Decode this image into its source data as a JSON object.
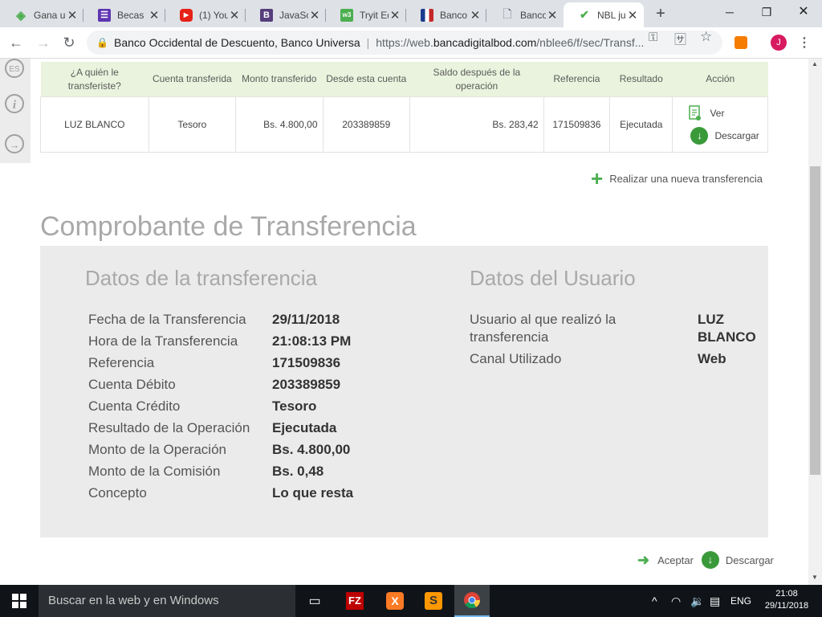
{
  "browser": {
    "tabs": [
      {
        "title": "Gana u",
        "active": false
      },
      {
        "title": "Becas",
        "active": false
      },
      {
        "title": "(1) You",
        "active": false
      },
      {
        "title": "JavaSc",
        "active": false
      },
      {
        "title": "Tryit Ed",
        "active": false
      },
      {
        "title": "Banco",
        "active": false
      },
      {
        "title": "Banco",
        "active": false
      },
      {
        "title": "NBL ju",
        "active": true
      }
    ],
    "new_tab": "+",
    "site_name": "Banco Occidental de Descuento, Banco Universa",
    "url_prefix": "https://web.",
    "url_domain": "bancadigitalbod.com",
    "url_path": "/nblee6/f/sec/Transf...",
    "profile_initial": "J"
  },
  "sidebar": {
    "lang": "ES",
    "info": "i",
    "logout": "→"
  },
  "table": {
    "headers": [
      "¿A quién le transferiste?",
      "Cuenta transferida",
      "Monto transferido",
      "Desde esta cuenta",
      "Saldo después de la operación",
      "Referencia",
      "Resultado",
      "Acción"
    ],
    "row": {
      "beneficiary": "LUZ BLANCO",
      "account": "Tesoro",
      "amount": "Bs. 4.800,00",
      "from_account": "203389859",
      "balance_after": "Bs. 283,42",
      "reference": "171509836",
      "result": "Ejecutada",
      "view_label": "Ver",
      "download_label": "Descargar"
    }
  },
  "new_transfer_label": "Realizar una nueva transferencia",
  "receipt": {
    "title": "Comprobante de Transferencia",
    "transfer_section": "Datos de la transferencia",
    "user_section": "Datos del Usuario",
    "fields": [
      {
        "label": "Fecha de la Transferencia",
        "value": "29/11/2018"
      },
      {
        "label": "Hora de la Transferencia",
        "value": "21:08:13 PM"
      },
      {
        "label": "Referencia",
        "value": "171509836"
      },
      {
        "label": "Cuenta Débito",
        "value": "203389859"
      },
      {
        "label": "Cuenta Crédito",
        "value": "Tesoro"
      },
      {
        "label": "Resultado de la Operación",
        "value": "Ejecutada"
      },
      {
        "label": "Monto de la Operación",
        "value": "Bs. 4.800,00"
      },
      {
        "label": "Monto de la Comisión",
        "value": "Bs. 0,48"
      },
      {
        "label": "Concepto",
        "value": "Lo que resta"
      }
    ],
    "user_fields": [
      {
        "label_line1": "Usuario al que realizó la",
        "label_line2": "transferencia",
        "value_line1": "LUZ",
        "value_line2": "BLANCO"
      },
      {
        "label": "Canal Utilizado",
        "value": "Web"
      }
    ]
  },
  "footer": {
    "accept_label": "Aceptar",
    "download_label": "Descargar"
  },
  "taskbar": {
    "search_placeholder": "Buscar en la web y en Windows",
    "lang": "ENG",
    "time": "21:08",
    "date": "29/11/2018"
  }
}
